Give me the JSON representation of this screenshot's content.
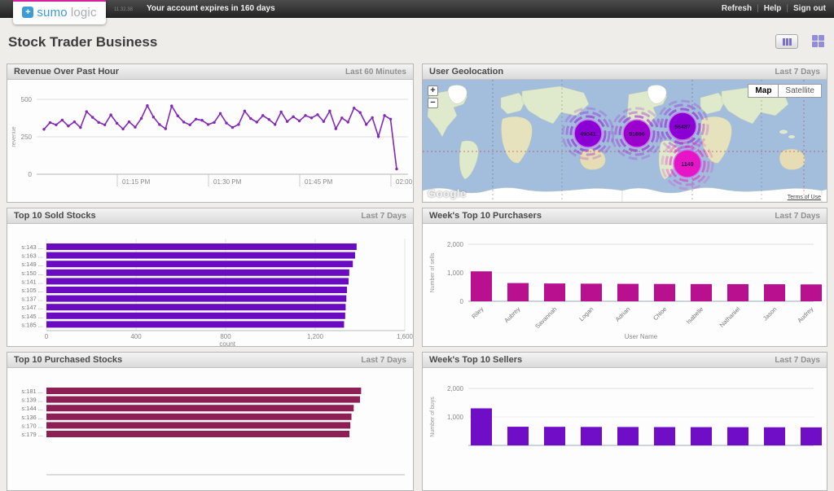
{
  "topbar": {
    "logo": {
      "plus": "+",
      "sumo": "sumo",
      "logic": "logic"
    },
    "video_timestamp": "11.32.38",
    "account_notice": "Your account expires in 160 days",
    "links": [
      {
        "label": "Refresh"
      },
      {
        "label": "Help"
      },
      {
        "label": "Sign out"
      }
    ]
  },
  "header": {
    "title": "Stock Trader Business"
  },
  "panels": {
    "revenue": {
      "title": "Revenue Over Past Hour",
      "range": "Last 60 Minutes"
    },
    "geolocation": {
      "title": "User Geolocation",
      "range": "Last 7 Days",
      "zoom_in": "+",
      "zoom_out": "−",
      "map_button": "Map",
      "satellite_button": "Satellite",
      "google_label": "Google",
      "terms_label": "Terms of Use",
      "markers": [
        {
          "value": "49341",
          "x": 203,
          "y": 66,
          "color": "#8b00d4"
        },
        {
          "value": "91696",
          "x": 263,
          "y": 66,
          "color": "#9c00cc"
        },
        {
          "value": "56487",
          "x": 319,
          "y": 57,
          "color": "#8b00d4"
        },
        {
          "value": "1149",
          "x": 325,
          "y": 103,
          "color": "#e616c6"
        }
      ]
    },
    "sold": {
      "title": "Top 10 Sold Stocks",
      "range": "Last 7 Days"
    },
    "purchasers": {
      "title": "Week's Top 10 Purchasers",
      "range": "Last 7 Days"
    },
    "purchased": {
      "title": "Top 10 Purchased Stocks",
      "range": "Last 7 Days"
    },
    "sellers": {
      "title": "Week's Top 10 Sellers",
      "range": "Last 7 Days"
    }
  },
  "chart_data": [
    {
      "id": "revenue",
      "type": "line",
      "title": "Revenue Over Past Hour",
      "ylabel": "revenue",
      "ylim": [
        0,
        500
      ],
      "yticks": [
        {
          "v": 0,
          "label": "0"
        },
        {
          "v": 250,
          "label": "250"
        },
        {
          "v": 500,
          "label": "500"
        }
      ],
      "xticks": [
        "01:15 PM",
        "01:30 PM",
        "01:45 PM",
        "02:00 PM"
      ],
      "color": "#8229b8",
      "values": [
        300,
        345,
        330,
        362,
        322,
        350,
        312,
        418,
        380,
        346,
        330,
        396,
        340,
        302,
        350,
        314,
        372,
        458,
        382,
        332,
        304,
        456,
        390,
        348,
        330,
        368,
        360,
        332,
        346,
        406,
        342,
        312,
        332,
        422,
        372,
        348,
        392,
        366,
        332,
        416,
        352,
        384,
        356,
        392,
        376,
        398,
        352,
        422,
        304,
        376,
        348,
        442,
        412,
        332,
        378,
        252,
        392,
        368,
        35
      ]
    },
    {
      "id": "sold",
      "type": "bar",
      "orientation": "horizontal",
      "title": "Top 10 Sold Stocks",
      "categories": [
        "s:143 ...",
        "s:163 ...",
        "s:149 ...",
        "s:150 ...",
        "s:141 ...",
        "s:105 ...",
        "s:137 ...",
        "s:147 ...",
        "s:145 ...",
        "s:185 ..."
      ],
      "values": [
        1385,
        1378,
        1368,
        1352,
        1349,
        1342,
        1339,
        1336,
        1334,
        1329
      ],
      "xlabel": "_count",
      "xlim": [
        0,
        1600
      ],
      "xticks": [
        {
          "v": 0,
          "label": "0"
        },
        {
          "v": 400,
          "label": "400"
        },
        {
          "v": 800,
          "label": "800"
        },
        {
          "v": 1200,
          "label": "1,200"
        },
        {
          "v": 1600,
          "label": "1,600"
        }
      ],
      "color": "#6a0bc2"
    },
    {
      "id": "purchasers",
      "type": "bar",
      "orientation": "vertical",
      "title": "Week's Top 10 Purchasers",
      "categories": [
        "Riley",
        "Aubrey",
        "Savannah",
        "Logan",
        "Adrian",
        "Chloe",
        "Isabelle",
        "Nathaniel",
        "Jason",
        "Audrey"
      ],
      "values": [
        1050,
        640,
        625,
        618,
        612,
        608,
        604,
        602,
        598,
        592
      ],
      "ylabel": "Number of sells",
      "xlabel": "User Name",
      "ylim": [
        0,
        2000
      ],
      "yticks": [
        {
          "v": 0,
          "label": "0"
        },
        {
          "v": 1000,
          "label": "1,000"
        },
        {
          "v": 2000,
          "label": "2,000"
        }
      ],
      "color": "#b8108e"
    },
    {
      "id": "purchased",
      "type": "bar",
      "orientation": "horizontal",
      "title": "Top 10 Purchased Stocks",
      "categories": [
        "s:181 ...",
        "s:139 ...",
        "s:144 ...",
        "s:136 ...",
        "s:170 ...",
        "s:179 ..."
      ],
      "values": [
        1405,
        1400,
        1372,
        1362,
        1357,
        1353
      ],
      "xlim": [
        0,
        1600
      ],
      "xticks": [],
      "color": "#8d1f55"
    },
    {
      "id": "sellers",
      "type": "bar",
      "orientation": "vertical",
      "title": "Week's Top 10 Sellers",
      "categories": [
        "",
        "",
        "",
        "",
        "",
        "",
        "",
        "",
        "",
        ""
      ],
      "values": [
        1300,
        655,
        652,
        648,
        646,
        643,
        641,
        639,
        636,
        633
      ],
      "ylabel": "Number of buys",
      "ylim": [
        0,
        2000
      ],
      "yticks": [
        {
          "v": 1000,
          "label": "1,000"
        },
        {
          "v": 2000,
          "label": "2,000"
        }
      ],
      "color": "#700dc6"
    }
  ],
  "colors": {
    "accent_magenta": "#d6219c",
    "logo_blue": "#3d9bd5",
    "map_ocean": "#a3bedd",
    "map_land": "#dfe9cc"
  }
}
